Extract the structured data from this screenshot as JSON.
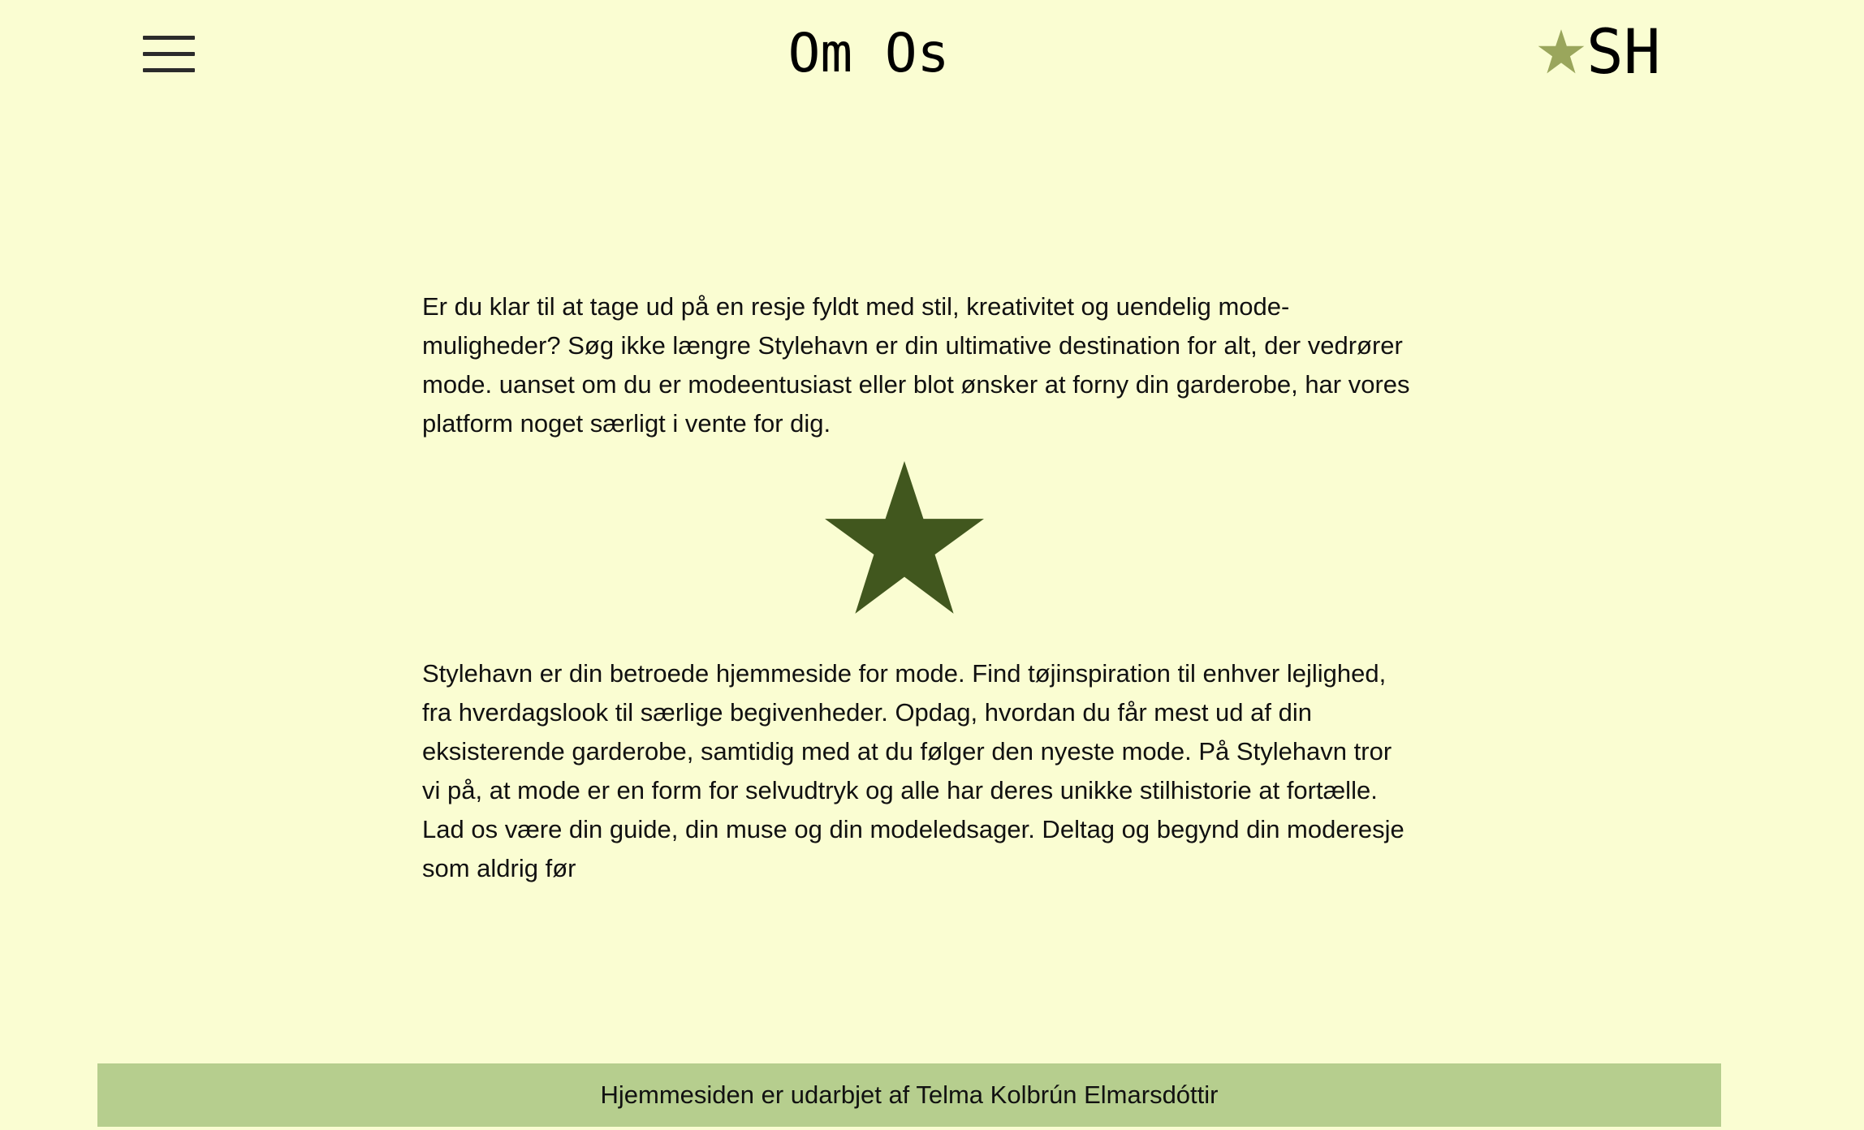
{
  "header": {
    "title": "Om Os",
    "logo_text": "SH",
    "menu_icon": "hamburger-menu-icon",
    "logo_icon": "star-icon"
  },
  "main": {
    "paragraph_1": "Er du klar til at tage ud på en resje fyldt med stil, kreativitet og uendelig mode-muligheder? Søg ikke længre Stylehavn er din ultimative destination for alt, der vedrører mode. uanset om du er modeentusiast eller blot ønsker at forny din garderobe, har vores platform noget særligt i vente for dig.",
    "divider_icon": "star-icon",
    "paragraph_2": "Stylehavn er din betroede hjemmeside for mode. Find tøjinspiration til enhver lejlighed, fra hverdagslook til særlige begivenheder. Opdag, hvordan du får mest ud af din eksisterende garderobe, samtidig med at du følger den nyeste mode. På Stylehavn tror vi på, at mode er en form for selvudtryk og alle har deres unikke stilhistorie at fortælle. Lad os være din guide, din muse og din modeledsager. Deltag og begynd din moderesje som aldrig før"
  },
  "footer": {
    "text": "Hjemmesiden er udarbjet af Telma Kolbrún Elmarsdóttir"
  },
  "colors": {
    "background": "#fafdd2",
    "footer_background": "#b6ce8e",
    "logo_star": "#9aa65c",
    "divider_star": "#41571e"
  }
}
